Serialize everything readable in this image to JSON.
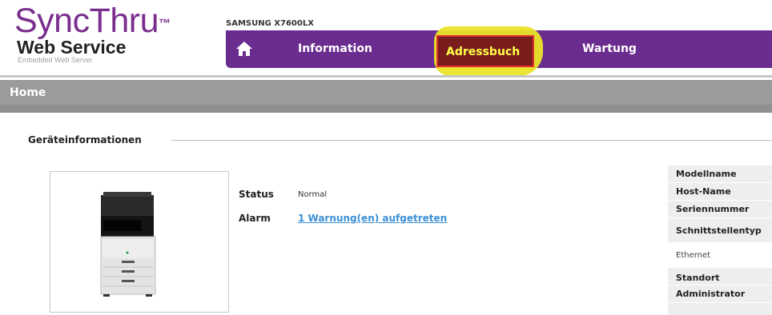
{
  "logo": {
    "line1": "SyncThru",
    "tm": "™",
    "line2": "Web Service",
    "line3": "Embedded Web Server"
  },
  "model": "SAMSUNG X7600LX",
  "nav": {
    "items": [
      {
        "label": "Information"
      },
      {
        "label": "Adressbuch"
      },
      {
        "label": "Wartung"
      }
    ]
  },
  "band": {
    "title": "Home"
  },
  "section": {
    "title": "Geräteinformationen"
  },
  "device": {
    "status_label": "Status",
    "status_value": "Normal",
    "alarm_label": "Alarm",
    "alarm_link": "1 Warnung(en) aufgetreten"
  },
  "panel": {
    "rows": [
      {
        "label": "Modellname"
      },
      {
        "label": "Host-Name"
      },
      {
        "label": "Seriennummer"
      },
      {
        "label": "Schnittstellentyp"
      },
      {
        "label": "Ethernet"
      },
      {
        "label": "Standort"
      },
      {
        "label": "Administrator"
      }
    ]
  },
  "colors": {
    "brand": "#6b2c8f",
    "highlight": "#e9e428",
    "link": "#3b8fd4"
  }
}
